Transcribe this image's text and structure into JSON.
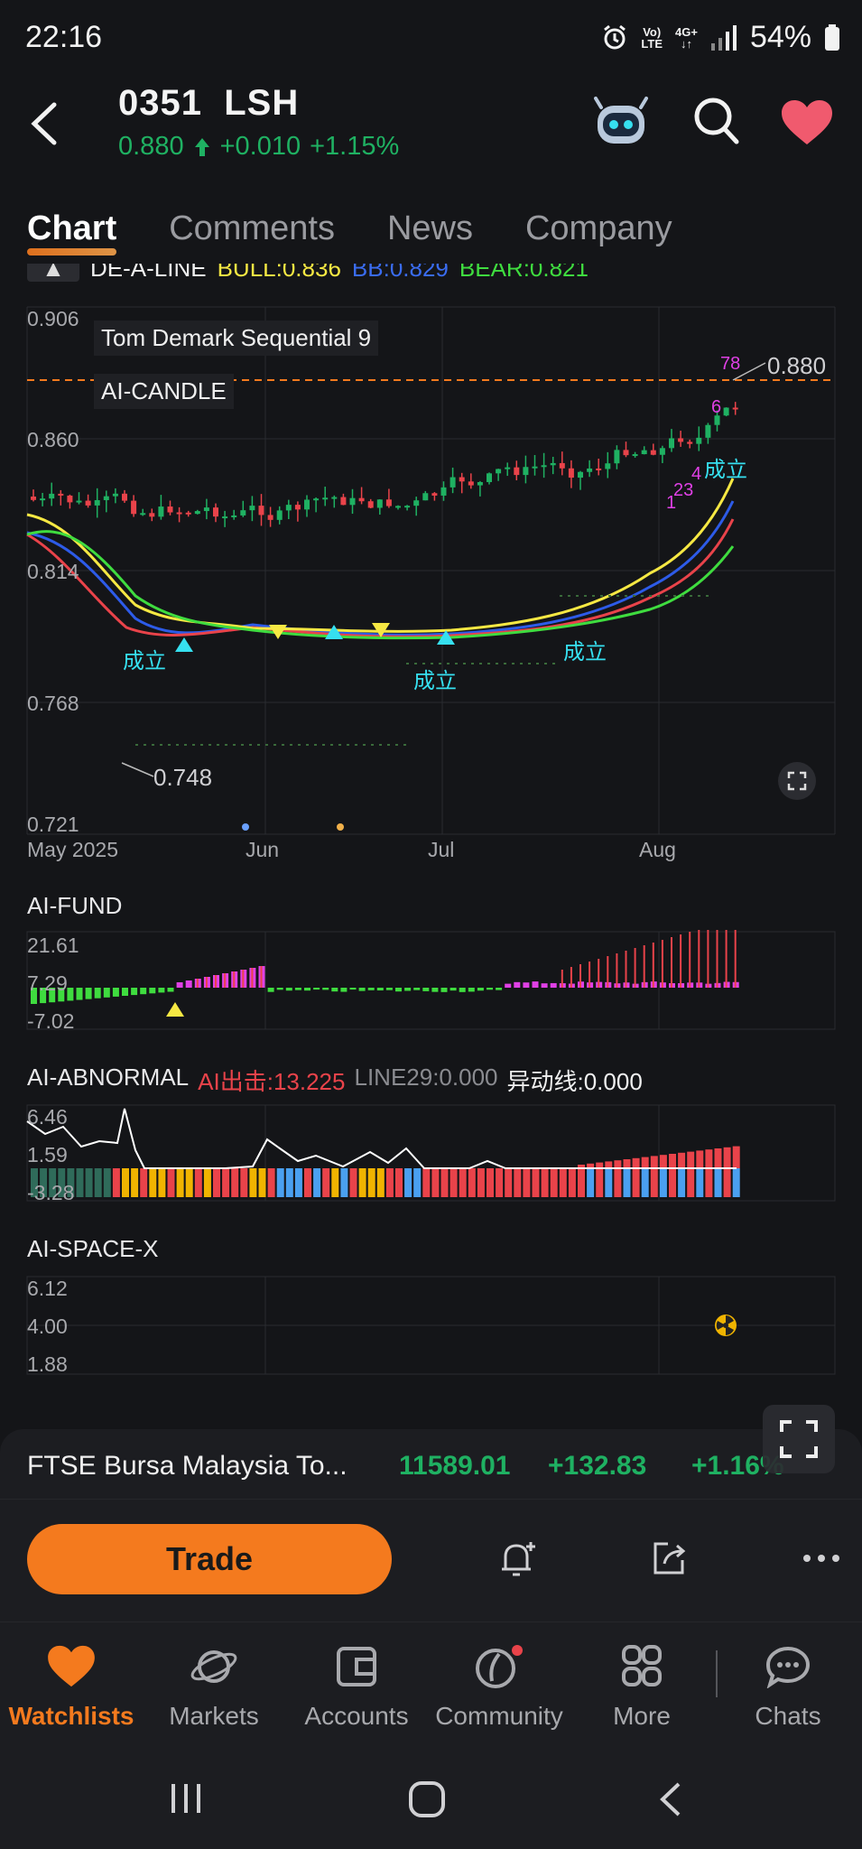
{
  "status": {
    "time": "22:16",
    "battery": "54%",
    "net_a": "Vo)",
    "net_b": "LTE",
    "net_c": "4G+"
  },
  "header": {
    "code": "0351",
    "name": "LSH",
    "price": "0.880",
    "change": "+0.010",
    "change_pct": "+1.15%"
  },
  "tabs": [
    {
      "label": "Chart"
    },
    {
      "label": "Comments"
    },
    {
      "label": "News"
    },
    {
      "label": "Company"
    }
  ],
  "indicator_line": {
    "name": "DE-A-LINE",
    "bull": "BULL:0.836",
    "bb": "BB:0.829",
    "bear": "BEAR:0.821"
  },
  "main_chart": {
    "label1": "Tom Demark Sequential 9",
    "label2": "AI-CANDLE",
    "y_ticks": [
      "0.906",
      "0.860",
      "0.814",
      "0.768",
      "0.721"
    ],
    "x_ticks": [
      "May 2025",
      "Jun",
      "Jul",
      "Aug"
    ],
    "last_price_label": "0.880",
    "low_label": "0.748",
    "signal_text": "成立",
    "td_numbers": [
      "1",
      "23",
      "4",
      "6",
      "78"
    ]
  },
  "fund_panel": {
    "title": "AI-FUND",
    "y_ticks": [
      "21.61",
      "7.29",
      "-7.02"
    ]
  },
  "abnormal_panel": {
    "title": "AI-ABNORMAL",
    "v1": "AI出击:13.225",
    "v2": "LINE29:0.000",
    "v3": "异动线:0.000",
    "y_ticks": [
      "6.46",
      "1.59",
      "-3.28"
    ]
  },
  "spacex_panel": {
    "title": "AI-SPACE-X",
    "y_ticks": [
      "6.12",
      "4.00",
      "1.88"
    ]
  },
  "index_bar": {
    "name": "FTSE Bursa Malaysia To...",
    "value": "11589.01",
    "change": "+132.83",
    "change_pct": "+1.16%"
  },
  "actions": {
    "trade": "Trade"
  },
  "nav": [
    {
      "label": "Watchlists"
    },
    {
      "label": "Markets"
    },
    {
      "label": "Accounts"
    },
    {
      "label": "Community"
    },
    {
      "label": "More"
    },
    {
      "label": "Chats"
    }
  ],
  "colors": {
    "up": "#1fb162",
    "down": "#e9434a",
    "accent": "#f47a1e",
    "cyan": "#36e0f0",
    "yellow": "#f6e843",
    "magenta": "#e040e6"
  }
}
